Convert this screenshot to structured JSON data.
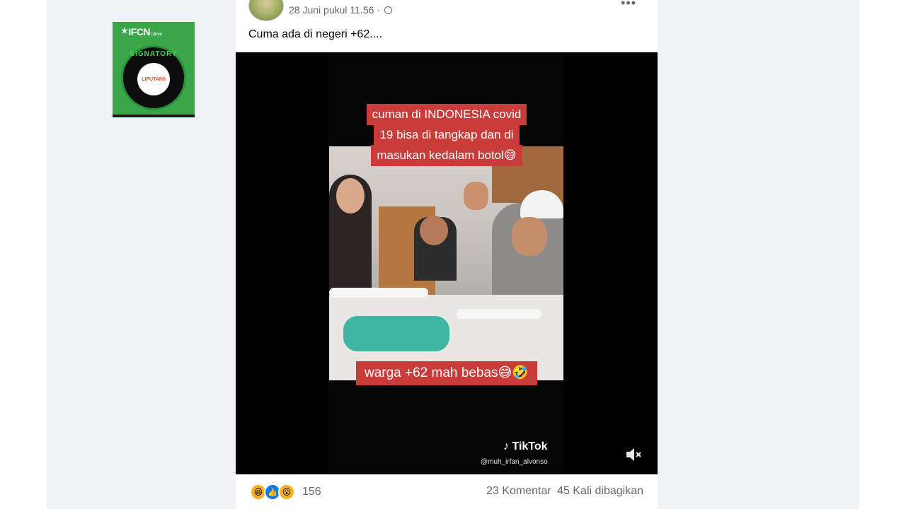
{
  "badge": {
    "org": "IFCN",
    "org_small": "Litmus",
    "ring_text": "SIGNATORY",
    "inner_text": "LIPUTAN6"
  },
  "post": {
    "date": "28 Juni pukul 11.56 ·",
    "text": "Cuma ada di negeri +62....",
    "more": "•••"
  },
  "video": {
    "caption_top": [
      "cuman di INDONESIA covid",
      "19 bisa di tangkap dan di",
      "masukan kedalam botol😅"
    ],
    "caption_bottom": "warga +62 mah bebas😅🤣",
    "tiktok_label": "TikTok",
    "tiktok_handle": "@muh_irfan_alvonso"
  },
  "footer": {
    "reaction_count": "156",
    "comments": "23 Komentar",
    "shares": "45 Kali dibagikan"
  },
  "icons": [
    "globe-icon",
    "more-icon",
    "tiktok-icon",
    "mute-icon",
    "haha-icon",
    "like-icon",
    "wow-icon"
  ]
}
